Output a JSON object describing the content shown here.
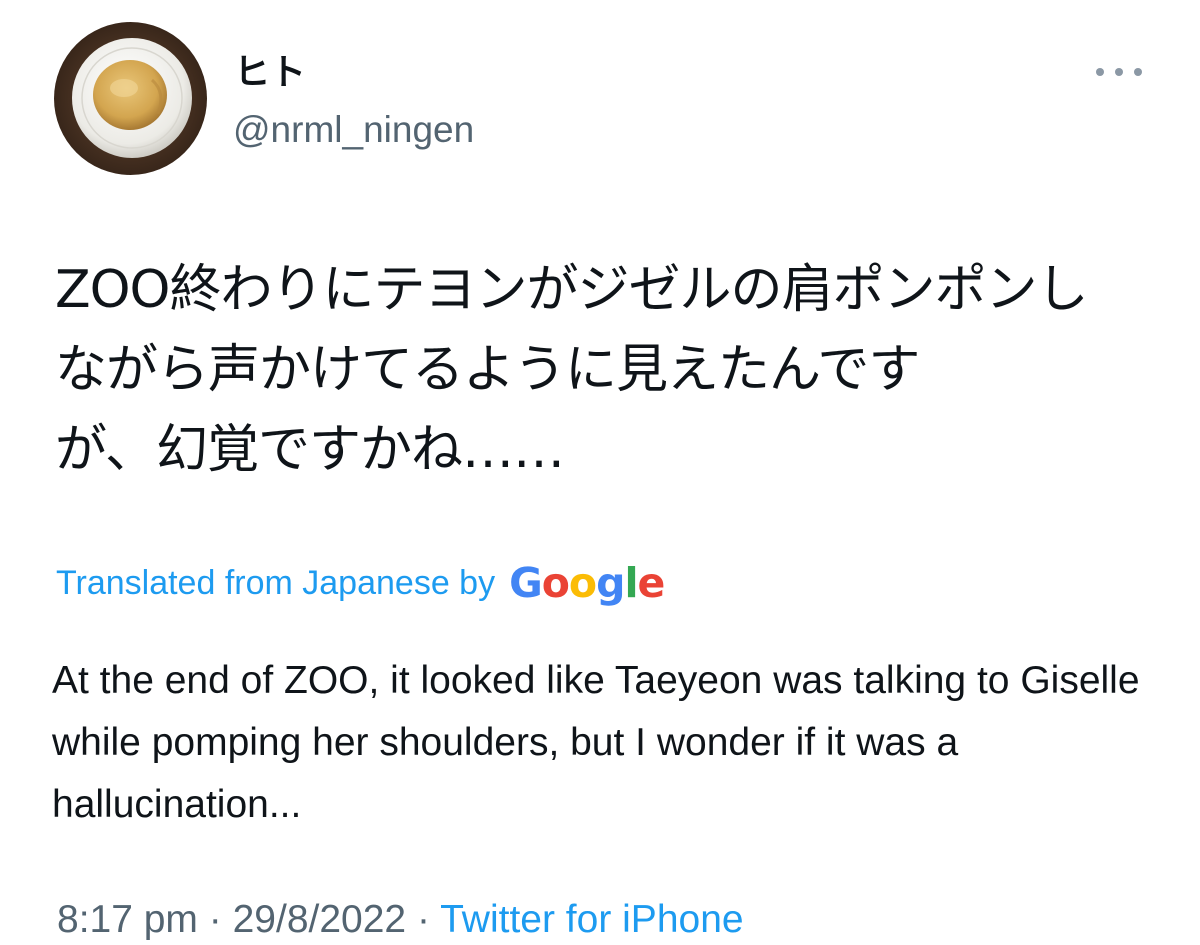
{
  "author": {
    "display_name": "ヒト",
    "handle": "@nrml_ningen",
    "avatar_icon": "pancake-plate-avatar"
  },
  "more_icon": "more-horizontal-icon",
  "tweet": {
    "text": "ZOO終わりにテヨンがジゼルの肩ポンポンし\nながら声かけてるように見えたんです\nが、幻覚ですかね……"
  },
  "translation": {
    "label": "Translated from Japanese by",
    "provider": {
      "letters": [
        "G",
        "o",
        "o",
        "g",
        "l",
        "e"
      ],
      "colors": [
        "#4285F4",
        "#EA4335",
        "#FBBC05",
        "#4285F4",
        "#34A853",
        "#EA4335"
      ]
    },
    "text": "At the end of ZOO, it looked like Taeyeon was talking to Giselle while pomping her shoulders, but I wonder if it was a hallucination..."
  },
  "meta": {
    "time": "8:17 pm",
    "separator": "·",
    "date": "29/8/2022",
    "source": "Twitter for iPhone"
  },
  "colors": {
    "accent": "#1d9bf0",
    "secondary_text": "#536471",
    "primary_text": "#0f1419"
  }
}
